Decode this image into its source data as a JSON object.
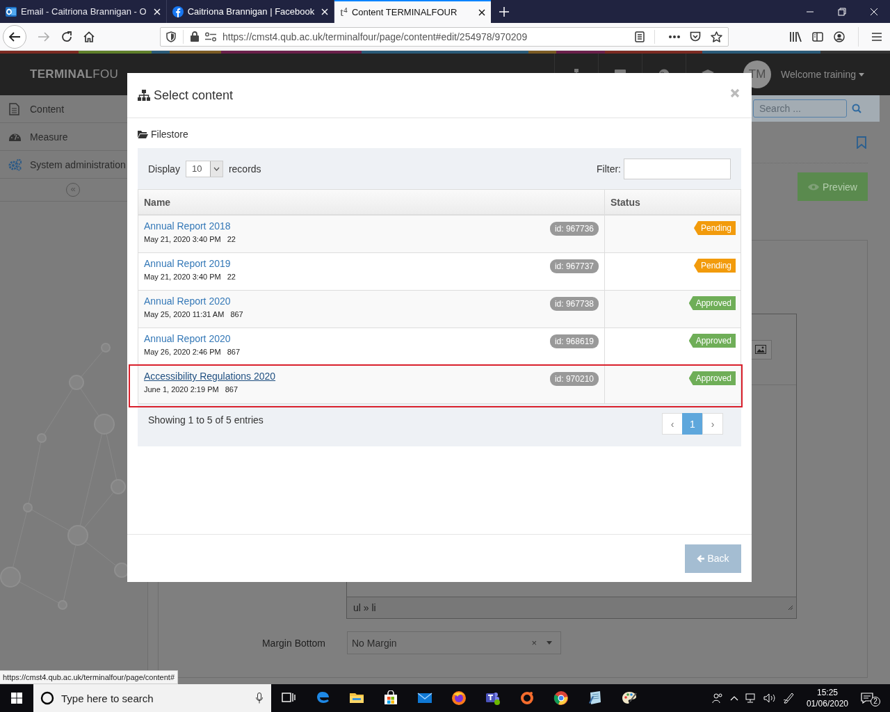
{
  "browser": {
    "tabs": [
      {
        "title": "Email - Caitriona Brannigan - O",
        "selected": false
      },
      {
        "title": "Caitriona Brannigan | Facebook",
        "selected": false
      },
      {
        "title": "Content TERMINALFOUR",
        "favicon": "t⁴",
        "selected": true
      }
    ],
    "url": "https://cmst4.qub.ac.uk/terminalfour/page/content#edit/254978/970209"
  },
  "app": {
    "logo": "**TERMINAL**FOU",
    "user_initials": "TM",
    "welcome": "Welcome training",
    "search_placeholder": "Search ...",
    "sidebar": [
      {
        "label": "Content"
      },
      {
        "label": "Measure"
      },
      {
        "label": "System administration"
      }
    ],
    "collapse": "«",
    "preview": "Preview",
    "editor_path": "ul » li",
    "margin_label": "Margin Bottom",
    "margin_value": "No Margin",
    "clear": "×"
  },
  "modal": {
    "title": "Select content",
    "breadcrumb": "Filestore",
    "display_label": "Display",
    "page_size": "10",
    "records_label": "records",
    "filter_label": "Filter:",
    "columns": [
      "Name",
      "Status"
    ],
    "rows": [
      {
        "name": "Annual Report 2018",
        "date": "May 21, 2020 3:40 PM",
        "size": "22",
        "id": "id: 967736",
        "status": "Pending",
        "color": "#f29b0c",
        "hovered": false,
        "highlighted": false
      },
      {
        "name": "Annual Report 2019",
        "date": "May 21, 2020 3:40 PM",
        "size": "22",
        "id": "id: 967737",
        "status": "Pending",
        "color": "#f29b0c",
        "hovered": false,
        "highlighted": false
      },
      {
        "name": "Annual Report 2020",
        "date": "May 25, 2020 11:31 AM",
        "size": "867",
        "id": "id: 967738",
        "status": "Approved",
        "color": "#6fae58",
        "hovered": false,
        "highlighted": false
      },
      {
        "name": "Annual Report 2020",
        "date": "May 26, 2020 2:46 PM",
        "size": "867",
        "id": "id: 968619",
        "status": "Approved",
        "color": "#6fae58",
        "hovered": false,
        "highlighted": false
      },
      {
        "name": "Accessibility Regulations 2020",
        "date": "June 1, 2020 2:19 PM",
        "size": "867",
        "id": "id: 970210",
        "status": "Approved",
        "color": "#6fae58",
        "hovered": true,
        "highlighted": true
      }
    ],
    "info": "Showing 1 to 5 of 5 entries",
    "prev": "‹",
    "next": "›",
    "pages": [
      {
        "label": "1",
        "selected": true
      }
    ],
    "back": "Back"
  },
  "status_link": "https://cmst4.qub.ac.uk/terminalfour/page/content#",
  "taskbar": {
    "search_placeholder": "Type here to search",
    "time": "15:25",
    "date": "01/06/2020",
    "notifications": "2"
  }
}
